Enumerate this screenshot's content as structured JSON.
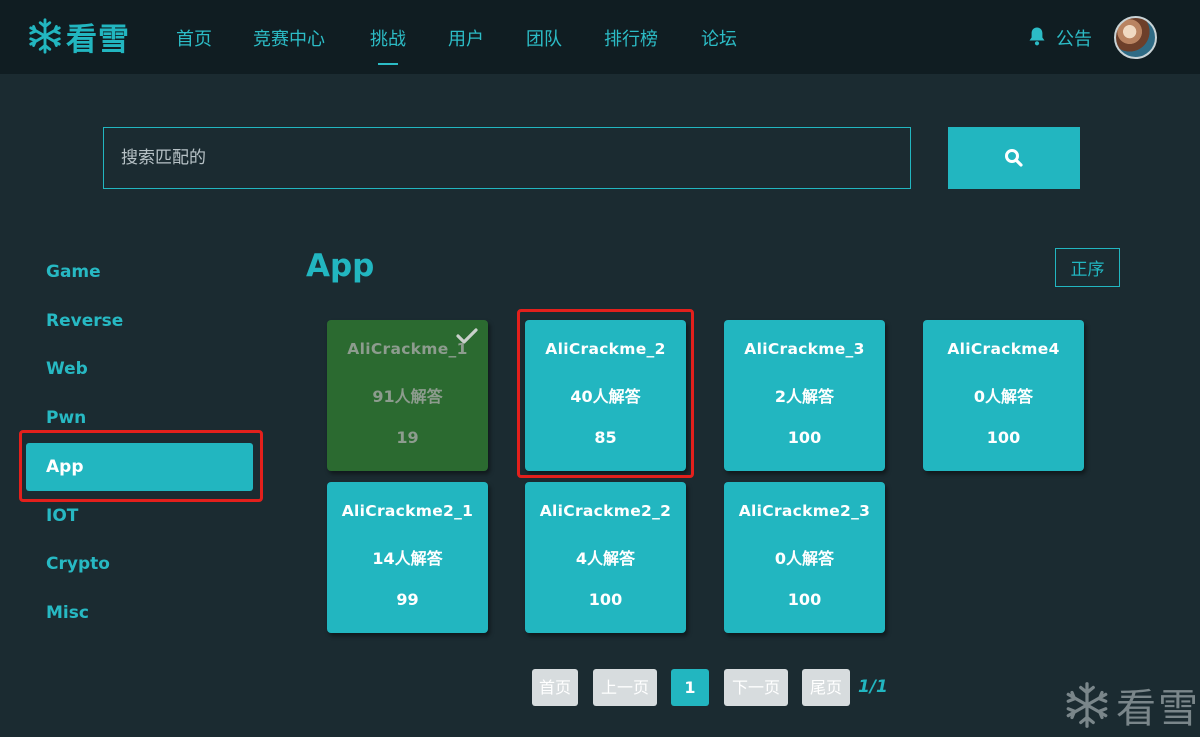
{
  "nav": {
    "logo_text": "看雪",
    "items": [
      "首页",
      "竞赛中心",
      "挑战",
      "用户",
      "团队",
      "排行榜",
      "论坛"
    ],
    "active": "挑战",
    "notice": "公告"
  },
  "search": {
    "placeholder": "搜索匹配的"
  },
  "sidebar": {
    "items": [
      "Game",
      "Reverse",
      "Web",
      "Pwn",
      "App",
      "IOT",
      "Crypto",
      "Misc"
    ],
    "active": "App"
  },
  "section": {
    "title": "App",
    "sort_label": "正序"
  },
  "challenges": [
    {
      "name": "AliCrackme_1",
      "solves": "91人解答",
      "score": "19",
      "solved": true
    },
    {
      "name": "AliCrackme_2",
      "solves": "40人解答",
      "score": "85",
      "solved": false
    },
    {
      "name": "AliCrackme_3",
      "solves": "2人解答",
      "score": "100",
      "solved": false
    },
    {
      "name": "AliCrackme4",
      "solves": "0人解答",
      "score": "100",
      "solved": false
    },
    {
      "name": "AliCrackme2_1",
      "solves": "14人解答",
      "score": "99",
      "solved": false
    },
    {
      "name": "AliCrackme2_2",
      "solves": "4人解答",
      "score": "100",
      "solved": false
    },
    {
      "name": "AliCrackme2_3",
      "solves": "0人解答",
      "score": "100",
      "solved": false
    }
  ],
  "pagination": {
    "first": "首页",
    "prev": "上一页",
    "current": "1",
    "next": "下一页",
    "last": "尾页",
    "info": "1/1"
  },
  "watermark": {
    "text": "看雪"
  },
  "colors": {
    "accent": "#22b6c0",
    "background": "#1b2b31",
    "nav_background": "#101d22",
    "solved_card": "#2b6a30",
    "highlight": "#e3201c"
  },
  "icons": {
    "logo": "snowflake-icon",
    "notice": "bell-icon",
    "search": "search-icon",
    "solved": "checkmark-icon"
  }
}
